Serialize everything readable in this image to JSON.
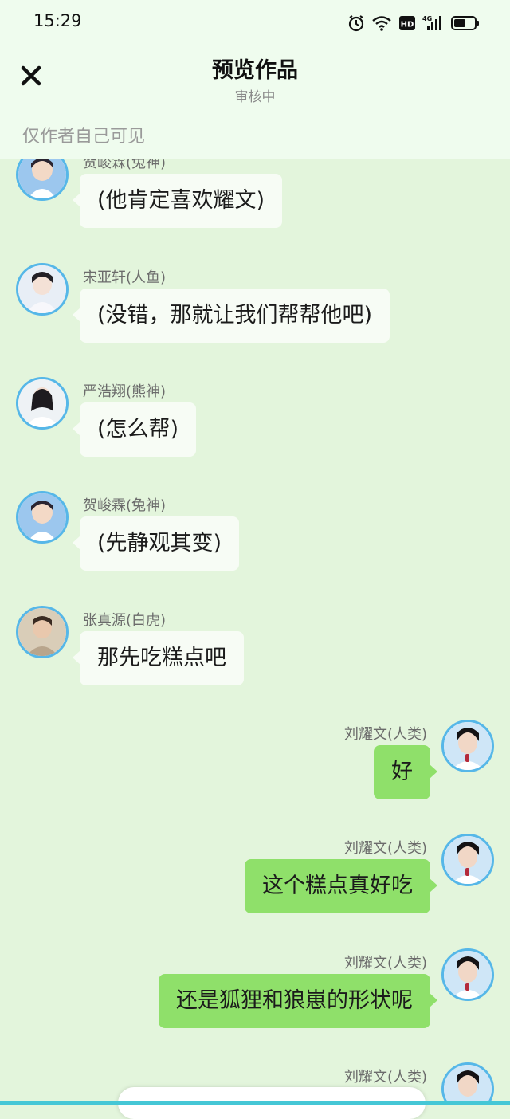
{
  "status_bar": {
    "time": "15:29",
    "network": "4G"
  },
  "header": {
    "title": "预览作品",
    "subtitle": "审核中",
    "visibility_note": "仅作者自己可见"
  },
  "messages": [
    {
      "side": "left",
      "name": "贺峻霖(兔神)",
      "text": "(他肯定喜欢耀文)",
      "avatar": "avatar-a"
    },
    {
      "side": "left",
      "name": "宋亚轩(人鱼)",
      "text": "(没错，那就让我们帮帮他吧)",
      "avatar": "avatar-b"
    },
    {
      "side": "left",
      "name": "严浩翔(熊神)",
      "text": "(怎么帮)",
      "avatar": "avatar-c"
    },
    {
      "side": "left",
      "name": "贺峻霖(兔神)",
      "text": "(先静观其变)",
      "avatar": "avatar-a"
    },
    {
      "side": "left",
      "name": "张真源(白虎)",
      "text": "那先吃糕点吧",
      "avatar": "avatar-d"
    },
    {
      "side": "right",
      "name": "刘耀文(人类)",
      "text": "好",
      "avatar": "avatar-e"
    },
    {
      "side": "right",
      "name": "刘耀文(人类)",
      "text": "这个糕点真好吃",
      "avatar": "avatar-e"
    },
    {
      "side": "right",
      "name": "刘耀文(人类)",
      "text": "还是狐狸和狼崽的形状呢",
      "avatar": "avatar-e"
    },
    {
      "side": "right",
      "name": "刘耀文(人类)",
      "text": "",
      "avatar": "avatar-e"
    }
  ],
  "colors": {
    "header_bg": "#effcee",
    "chat_bg": "#e3f5dc",
    "left_bubble": "#f7fcf5",
    "right_bubble": "#8fe06a",
    "avatar_ring": "#56b7e8"
  }
}
